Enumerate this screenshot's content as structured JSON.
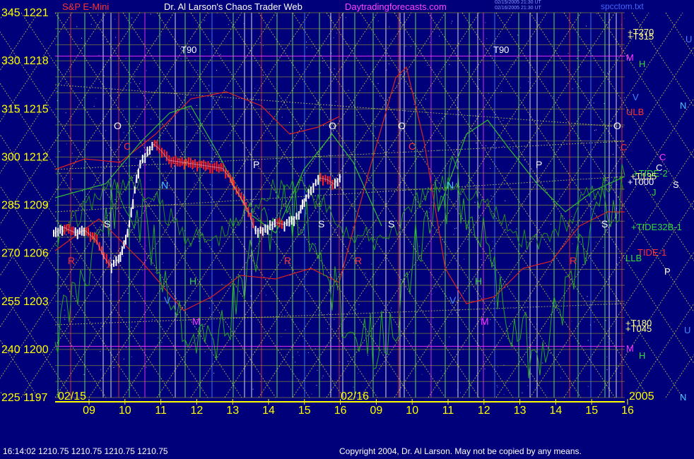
{
  "header": {
    "instrument": "S&P E-Mini",
    "title": "Dr. Al Larson's Chaos Trader Web",
    "site": "Daytradingforecasts.com",
    "stamp1": "02/15/2005 21:30 UT",
    "stamp2": "02/16/2005 21:30 UT",
    "filename": "spcctom.txt"
  },
  "footer": {
    "quote": "16:14:02  1210.75 1210.75 1210.75 1210.75",
    "copyright": "Copyright 2004, Dr. Al Larson. May not be copied by any means."
  },
  "colors": {
    "background": "#00007a",
    "price_up": "#ffffff",
    "price_down": "#ff2020",
    "wave": "#22aa22",
    "band": "#dd2222",
    "grid": "#aaaa22",
    "axis_text": "#ffff00"
  },
  "chart_data": {
    "type": "line",
    "ylim": [
      1197,
      1221
    ],
    "y_ticks": [
      {
        "deg": "345",
        "price": "1221",
        "value": 1221
      },
      {
        "deg": "330",
        "price": "1218",
        "value": 1218
      },
      {
        "deg": "315",
        "price": "1215",
        "value": 1215
      },
      {
        "deg": "300",
        "price": "1212",
        "value": 1212
      },
      {
        "deg": "285",
        "price": "1209",
        "value": 1209
      },
      {
        "deg": "270",
        "price": "1206",
        "value": 1206
      },
      {
        "deg": "255",
        "price": "1203",
        "value": 1203
      },
      {
        "deg": "240",
        "price": "1200",
        "value": 1200
      },
      {
        "deg": "225",
        "price": "1197",
        "value": 1197
      }
    ],
    "x_ticks": [
      "09",
      "10",
      "11",
      "12",
      "13",
      "14",
      "15",
      "16",
      "09",
      "10",
      "11",
      "12",
      "13",
      "14",
      "15",
      "16"
    ],
    "date_labels": [
      "02/15",
      "02/16",
      "2005"
    ],
    "series": [
      {
        "name": "price",
        "x": [
          8.0,
          8.3,
          8.6,
          8.9,
          9.2,
          9.4,
          9.6,
          9.8,
          9.9,
          10.0,
          10.1,
          10.2,
          10.3,
          10.4,
          10.6,
          10.8,
          11.0,
          11.2,
          11.5,
          11.8,
          12.1,
          12.4,
          12.7,
          12.9,
          13.0,
          13.2,
          13.4,
          13.6,
          13.8,
          14.0,
          14.2,
          14.4,
          14.6,
          14.8,
          14.9,
          15.0,
          15.2,
          15.4,
          15.6,
          15.8,
          16.0
        ],
        "values": [
          1207.2,
          1207.6,
          1207.3,
          1207.4,
          1206.8,
          1205.8,
          1205.2,
          1205.6,
          1206.2,
          1206.8,
          1207.8,
          1209.2,
          1210.6,
          1211.6,
          1212.3,
          1212.8,
          1212.4,
          1211.8,
          1211.7,
          1211.6,
          1211.5,
          1211.4,
          1211.3,
          1210.7,
          1210.2,
          1209.5,
          1208.7,
          1207.4,
          1207.4,
          1207.7,
          1207.9,
          1207.8,
          1208.0,
          1208.4,
          1209.0,
          1209.4,
          1210.2,
          1210.7,
          1210.6,
          1210.3,
          1210.8
        ]
      }
    ],
    "line_labels": [
      {
        "text": "T90",
        "color": "#ffffff"
      },
      {
        "text": "T90",
        "color": "#ffffff"
      },
      {
        "text": "+T270",
        "color": "#ffff88"
      },
      {
        "text": "+T315",
        "color": "#ffff88"
      },
      {
        "text": "M",
        "color": "#ff33ff"
      },
      {
        "text": "H",
        "color": "#33dd33"
      },
      {
        "text": "V",
        "color": "#4488ff"
      },
      {
        "text": "ULB",
        "color": "#ff3333"
      },
      {
        "text": "C",
        "color": "#ff3333"
      },
      {
        "text": "C",
        "color": "#ff33ff"
      },
      {
        "text": "C",
        "color": "#ffffff"
      },
      {
        "text": "+TIDE-2",
        "color": "#33dd33"
      },
      {
        "text": "+T135",
        "color": "#ffff88"
      },
      {
        "text": "+T000",
        "color": "#ffffff"
      },
      {
        "text": "J",
        "color": "#33dd33"
      },
      {
        "text": "+TIDE32B-1",
        "color": "#33dd33"
      },
      {
        "text": "TIDE-1",
        "color": "#ff3333"
      },
      {
        "text": "LLB",
        "color": "#33dd33"
      },
      {
        "text": "+T180",
        "color": "#ffff88"
      },
      {
        "text": "+T045",
        "color": "#ffff88"
      },
      {
        "text": "M",
        "color": "#ff33ff"
      },
      {
        "text": "H",
        "color": "#33dd33"
      },
      {
        "text": "U",
        "color": "#4488ff"
      },
      {
        "text": "N",
        "color": "#44ccff"
      },
      {
        "text": "S",
        "color": "#ffffff"
      },
      {
        "text": "P",
        "color": "#ffffff"
      },
      {
        "text": "U",
        "color": "#4488ff"
      },
      {
        "text": "N",
        "color": "#44ccff"
      }
    ],
    "markers": [
      {
        "text": "O",
        "color": "#ffffff"
      },
      {
        "text": "O",
        "color": "#ffffff"
      },
      {
        "text": "O",
        "color": "#ffffff"
      },
      {
        "text": "O",
        "color": "#ffffff"
      },
      {
        "text": "C",
        "color": "#ff3333"
      },
      {
        "text": "C",
        "color": "#ff3333"
      },
      {
        "text": "N",
        "color": "#44ccff"
      },
      {
        "text": "N",
        "color": "#44ccff"
      },
      {
        "text": "P",
        "color": "#ffffff"
      },
      {
        "text": "P",
        "color": "#ffffff"
      },
      {
        "text": "S",
        "color": "#ffffff"
      },
      {
        "text": "S",
        "color": "#ffffff"
      },
      {
        "text": "S",
        "color": "#ffffff"
      },
      {
        "text": "S",
        "color": "#ffffff"
      },
      {
        "text": "R",
        "color": "#ff3333"
      },
      {
        "text": "R",
        "color": "#ff3333"
      },
      {
        "text": "R",
        "color": "#ff3333"
      },
      {
        "text": "R",
        "color": "#ff3333"
      },
      {
        "text": "H",
        "color": "#33dd33"
      },
      {
        "text": "H",
        "color": "#33dd33"
      },
      {
        "text": "M",
        "color": "#ff33ff"
      },
      {
        "text": "M",
        "color": "#ff33ff"
      },
      {
        "text": "V",
        "color": "#4488ff"
      },
      {
        "text": "V",
        "color": "#4488ff"
      }
    ]
  }
}
